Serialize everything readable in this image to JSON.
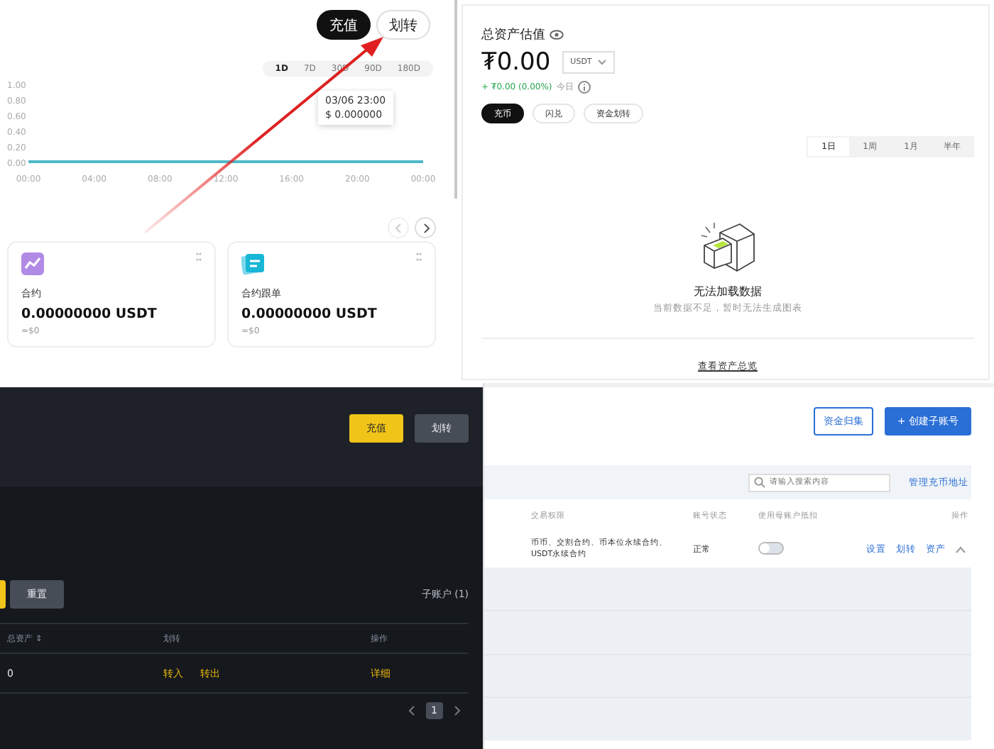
{
  "overview": {
    "buttons": [
      {
        "label": "充值",
        "kind": "primary"
      },
      {
        "label": "划转",
        "kind": "secondary"
      }
    ],
    "ranges": [
      {
        "label": "1D",
        "selected": true
      },
      {
        "label": "7D",
        "selected": false
      },
      {
        "label": "30D",
        "selected": false
      },
      {
        "label": "90D",
        "selected": false
      },
      {
        "label": "180D",
        "selected": false
      }
    ],
    "chart_data": {
      "type": "line",
      "x": [
        "00:00",
        "04:00",
        "08:00",
        "12:00",
        "16:00",
        "20:00",
        "00:00"
      ],
      "yticks": [
        {
          "value": 0,
          "label": "0.00"
        },
        {
          "value": 0.2,
          "label": "0.20"
        },
        {
          "value": 0.4,
          "label": "0.40"
        },
        {
          "value": 0.6,
          "label": "0.60"
        },
        {
          "value": 0.8,
          "label": "0.80"
        },
        {
          "value": 1,
          "label": "1.00"
        }
      ],
      "ylim": [
        0,
        1
      ],
      "series": [
        {
          "color": "#4fb8c8",
          "values": [
            0,
            0,
            0,
            0,
            0,
            0,
            0
          ]
        }
      ]
    },
    "tooltip": {
      "time": "03/06 23:00",
      "value": "$ 0.000000"
    },
    "cards": [
      {
        "kind": "contract",
        "title": "合约",
        "amount": "0.00000000 USDT",
        "fiat": "≈$0"
      },
      {
        "kind": "copy",
        "title": "合约跟单",
        "amount": "0.00000000 USDT",
        "fiat": "≈$0"
      }
    ]
  },
  "assets": {
    "title": "总资产估值",
    "amount": "₮0.00",
    "currency": "USDT",
    "change": "+ ₮0.00 (0.00%)",
    "period": "今日",
    "actions": [
      {
        "label": "充币",
        "selected": true
      },
      {
        "label": "闪兑",
        "selected": false
      },
      {
        "label": "资金划转",
        "selected": false
      }
    ],
    "tabs": [
      {
        "label": "1日",
        "selected": true
      },
      {
        "label": "1周",
        "selected": false
      },
      {
        "label": "1月",
        "selected": false
      },
      {
        "label": "半年",
        "selected": false
      }
    ],
    "empty_title": "无法加载数据",
    "empty_text": "当前数据不足，暂时无法生成图表",
    "link": "查看资产总览"
  },
  "dark_panel": {
    "buttons": [
      {
        "label": "充值",
        "kind": "primary"
      },
      {
        "label": "划转",
        "kind": "secondary"
      }
    ],
    "reset": "重置",
    "count": "子账户 (1)",
    "columns": [
      "总资产 ⇕",
      "划转",
      "操作"
    ],
    "rows": [
      {
        "total": "0",
        "transfer_in": "转入",
        "transfer_out": "转出",
        "detail": "详细"
      }
    ],
    "pages": [
      {
        "label": "1",
        "selected": true
      }
    ]
  },
  "sub_accounts": {
    "buttons": [
      {
        "label": "资金归集",
        "kind": "outline"
      },
      {
        "label": "+ 创建子账号",
        "kind": "primary"
      }
    ],
    "search": {
      "placeholder": "请输入搜索内容"
    },
    "manage_link": "管理充币地址",
    "columns": [
      "交易权限",
      "账号状态",
      "使用母账户抵扣",
      "操作"
    ],
    "rows": [
      {
        "permissions": "币币、交割合约、币本位永续合约、USDT永续合约",
        "status": "正常",
        "on": false,
        "actions": [
          "设置",
          "划转",
          "资产"
        ]
      }
    ]
  }
}
